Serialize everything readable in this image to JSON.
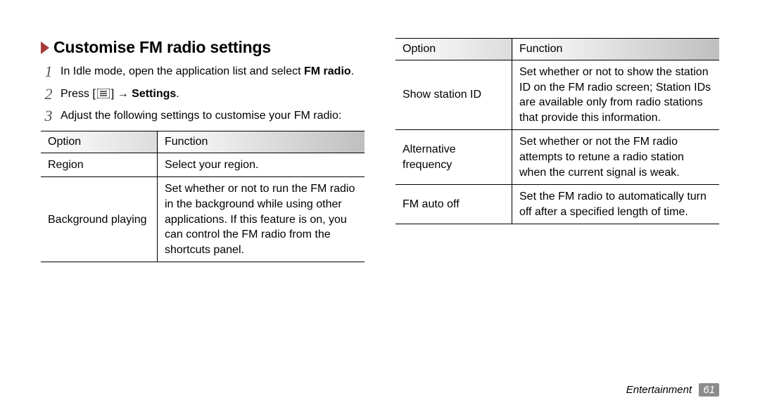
{
  "heading": "Customise FM radio settings",
  "steps": [
    {
      "num": "1",
      "pre": "In Idle mode, open the application list and select ",
      "bold": "FM radio",
      "post": "."
    },
    {
      "num": "2",
      "pre": "Press [",
      "iconThenArrow": true,
      "afterIcon": "] → ",
      "bold": "Settings",
      "post": "."
    },
    {
      "num": "3",
      "pre": "Adjust the following settings to customise your FM radio:",
      "bold": "",
      "post": ""
    }
  ],
  "table1": {
    "head": {
      "option": "Option",
      "function": "Function"
    },
    "rows": [
      {
        "option": "Region",
        "function": "Select your region."
      },
      {
        "option": "Background playing",
        "function": "Set whether or not to run the FM radio in the background while using other applications. If this feature is on, you can control the FM radio from the shortcuts panel."
      }
    ]
  },
  "table2": {
    "head": {
      "option": "Option",
      "function": "Function"
    },
    "rows": [
      {
        "option": "Show station ID",
        "function": "Set whether or not to show the station ID on the FM radio screen; Station IDs are available only from radio stations that provide this information."
      },
      {
        "option": "Alternative frequency",
        "function": "Set whether or not the FM radio attempts to retune a radio station when the current signal is weak."
      },
      {
        "option": "FM auto off",
        "function": "Set the FM radio to automatically turn off after a specified length of time."
      }
    ]
  },
  "footer": {
    "section": "Entertainment",
    "page": "61"
  }
}
